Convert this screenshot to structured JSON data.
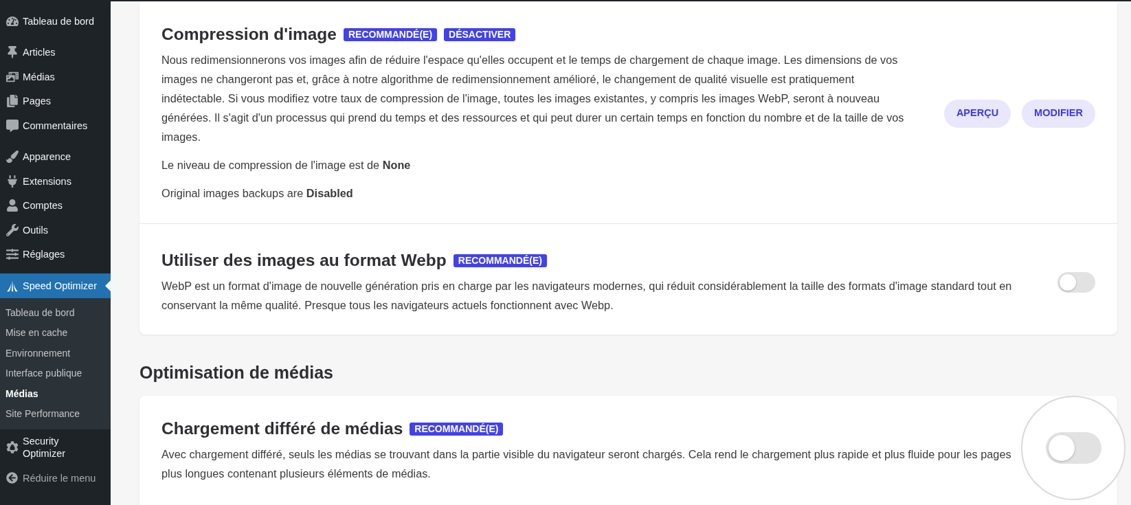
{
  "sidebar": {
    "groups": [
      [
        {
          "label": "Tableau de bord",
          "selected": false
        }
      ],
      [
        {
          "label": "Articles",
          "selected": false
        },
        {
          "label": "Médias",
          "selected": false
        },
        {
          "label": "Pages",
          "selected": false
        },
        {
          "label": "Commentaires",
          "selected": false
        }
      ],
      [
        {
          "label": "Apparence",
          "selected": false
        },
        {
          "label": "Extensions",
          "selected": false
        },
        {
          "label": "Comptes",
          "selected": false
        },
        {
          "label": "Outils",
          "selected": false
        },
        {
          "label": "Réglages",
          "selected": false
        }
      ],
      [
        {
          "label": "Speed Optimizer",
          "selected": true,
          "children": [
            {
              "label": "Tableau de bord",
              "selected": false
            },
            {
              "label": "Mise en cache",
              "selected": false
            },
            {
              "label": "Environnement",
              "selected": false
            },
            {
              "label": "Interface publique",
              "selected": false
            },
            {
              "label": "Médias",
              "selected": true
            },
            {
              "label": "Site Performance",
              "selected": false
            }
          ]
        },
        {
          "label": "Security Optimizer",
          "selected": false
        }
      ]
    ],
    "collapse": {
      "label": "Réduire le menu"
    }
  },
  "sections": [
    {
      "panels": [
        {
          "title": "Compression d'image",
          "badges": [
            "RECOMMANDÉ(E)",
            "DÉSACTIVER"
          ],
          "paragraphs": [
            "Nous redimensionnerons vos images afin de réduire l'espace qu'elles occupent et le temps de chargement de chaque image. Les dimensions de vos images ne changeront pas et, grâce à notre algorithme de redimensionnement amélioré, le changement de qualité visuelle est pratiquement indétectable. Si vous modifiez votre taux de compression de l'image, toutes les images existantes, y compris les images WebP, seront à nouveau générées. Il s'agit d'un processus qui prend du temps et des ressources et qui peut durer un certain temps en fonction du nombre et de la taille de vos images.",
            "Le niveau de compression de l'image est de **None**",
            "Original images backups are **Disabled**"
          ],
          "buttons": [
            "APERÇU",
            "MODIFIER"
          ]
        },
        {
          "title": "Utiliser des images au format Webp",
          "badges": [
            "RECOMMANDÉ(E)"
          ],
          "paragraphs": [
            "WebP est un format d'image de nouvelle génération pris en charge par les navigateurs modernes, qui réduit considérablement la taille des formats d'image standard tout en conservant la même qualité. Presque tous les navigateurs actuels fonctionnent avec Webp."
          ],
          "toggle": {
            "on": false,
            "magnified": false
          }
        }
      ]
    },
    {
      "heading": "Optimisation de médias",
      "panels": [
        {
          "title": "Chargement différé de médias",
          "badges": [
            "RECOMMANDÉ(E)"
          ],
          "paragraphs": [
            "Avec chargement différé, seuls les médias se trouvant dans la partie visible du navigateur seront chargés. Cela rend le chargement plus rapide et plus fluide pour les pages plus longues contenant plusieurs éléments de médias."
          ],
          "toggle": {
            "on": false,
            "magnified": true
          }
        }
      ]
    }
  ]
}
